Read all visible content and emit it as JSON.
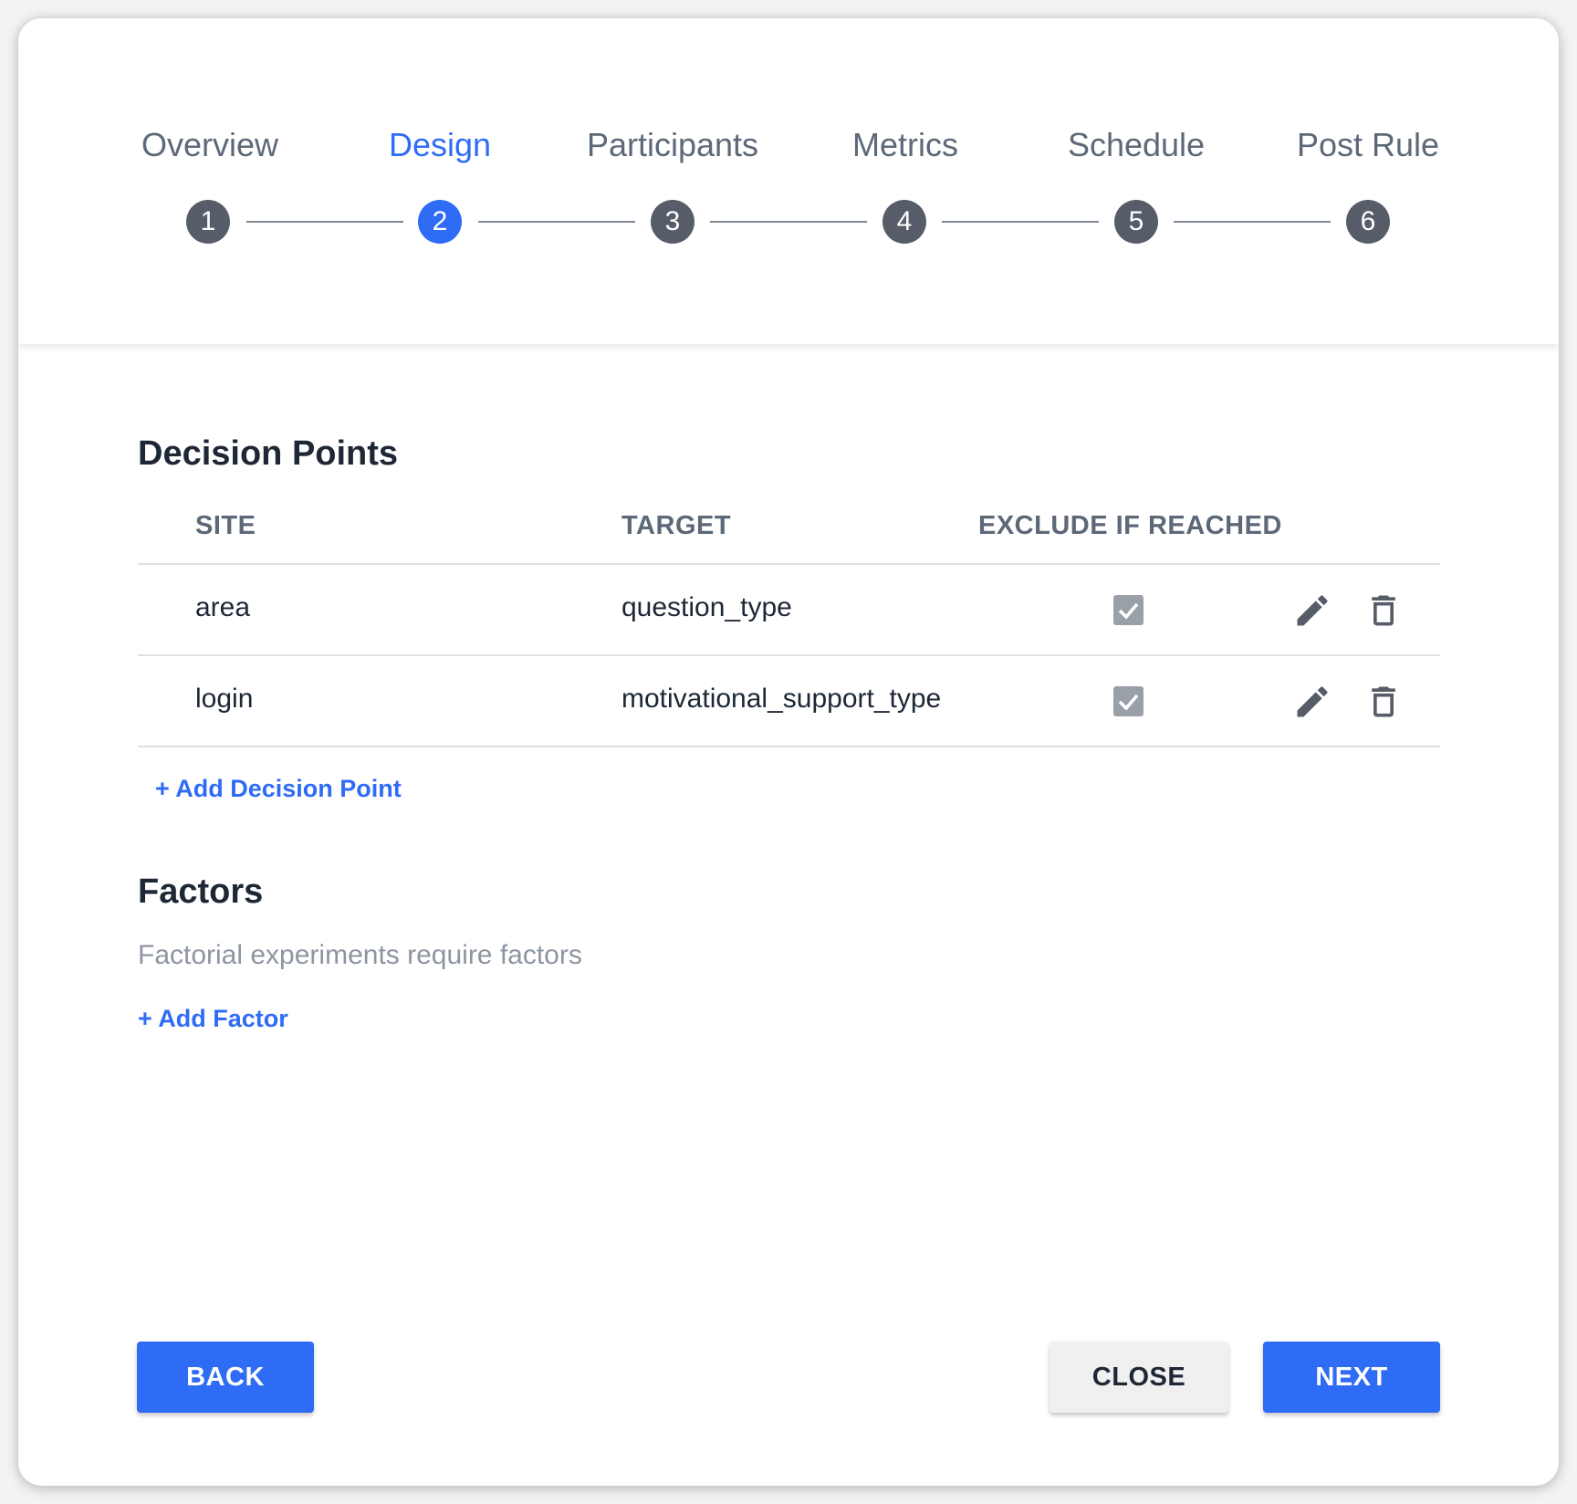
{
  "stepper": {
    "steps": [
      {
        "label": "Overview",
        "number": "1"
      },
      {
        "label": "Design",
        "number": "2"
      },
      {
        "label": "Participants",
        "number": "3"
      },
      {
        "label": "Metrics",
        "number": "4"
      },
      {
        "label": "Schedule",
        "number": "5"
      },
      {
        "label": "Post Rule",
        "number": "6"
      }
    ],
    "active_step": "Design"
  },
  "decision_points": {
    "title": "Decision Points",
    "columns": {
      "site": "SITE",
      "target": "TARGET",
      "exclude": "EXCLUDE IF REACHED"
    },
    "rows": [
      {
        "site": "area",
        "target": "question_type",
        "exclude_if_reached": true
      },
      {
        "site": "login",
        "target": "motivational_support_type",
        "exclude_if_reached": true
      }
    ],
    "add_label": "+ Add Decision Point"
  },
  "factors": {
    "title": "Factors",
    "hint": "Factorial experiments require factors",
    "add_label": "+ Add Factor"
  },
  "footer": {
    "back_label": "BACK",
    "close_label": "CLOSE",
    "next_label": "NEXT"
  },
  "icons": {
    "edit": "pencil-icon",
    "delete": "trash-icon",
    "checkbox": "checkmark-icon"
  },
  "colors": {
    "accent": "#2f6cf5",
    "step_inactive": "#565d68",
    "text_dark": "#1d2735",
    "text_muted": "#8d95a1",
    "checkbox_checked": "#9aa0a8"
  }
}
